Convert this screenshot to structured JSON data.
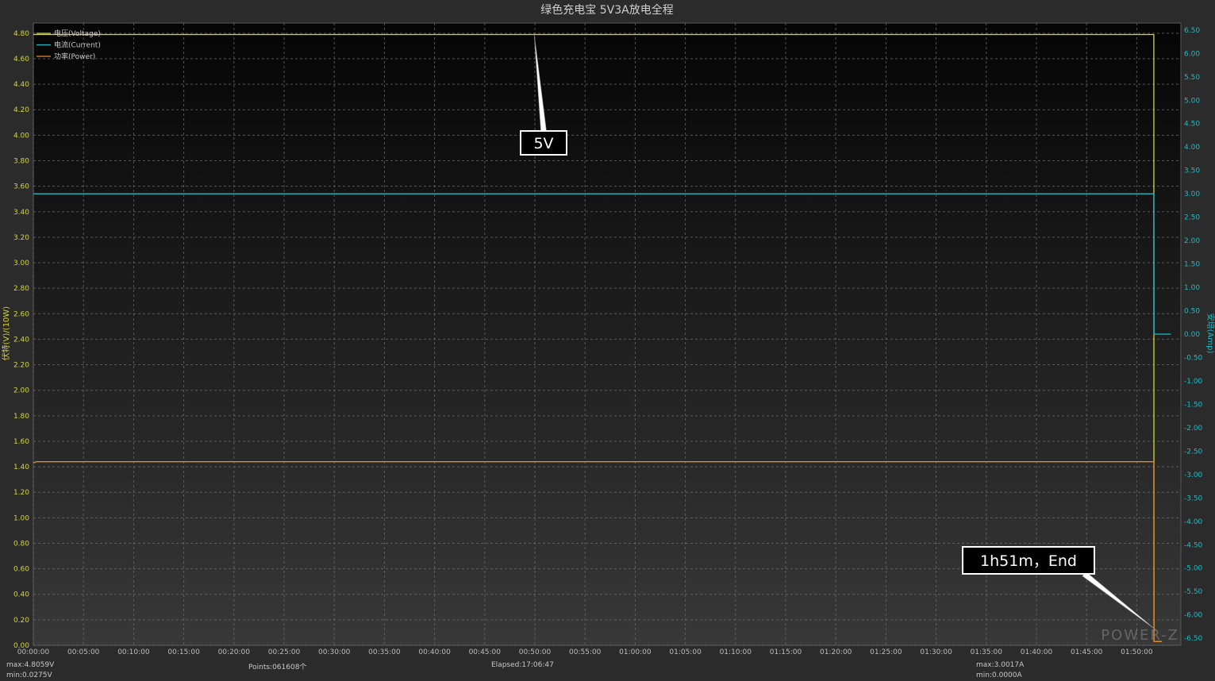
{
  "chart_data": {
    "type": "line",
    "title": "绿色充电宝 5V3A放电全程",
    "x": [
      "00:00:00",
      "00:05:00",
      "00:10:00",
      "00:15:00",
      "00:20:00",
      "00:25:00",
      "00:30:00",
      "00:35:00",
      "00:40:00",
      "00:45:00",
      "00:50:00",
      "00:55:00",
      "01:00:00",
      "01:05:00",
      "01:10:00",
      "01:15:00",
      "01:20:00",
      "01:25:00",
      "01:30:00",
      "01:35:00",
      "01:40:00",
      "01:45:00",
      "01:50:00"
    ],
    "xlim_minutes": [
      0,
      114.4
    ],
    "ylabel_left": "伏特(V)/(10W)",
    "ylabel_right": "安培(Amp)",
    "ylim_left": [
      0,
      4.88
    ],
    "ylim_right": [
      -6.65,
      6.65
    ],
    "yticks_left": [
      "0.00",
      "0.20",
      "0.40",
      "0.60",
      "0.80",
      "1.00",
      "1.20",
      "1.40",
      "1.60",
      "1.80",
      "2.00",
      "2.20",
      "2.40",
      "2.60",
      "2.80",
      "3.00",
      "3.20",
      "3.40",
      "3.60",
      "3.80",
      "4.00",
      "4.20",
      "4.40",
      "4.60",
      "4.80"
    ],
    "yticks_right": [
      "-6.50",
      "-6.00",
      "-5.50",
      "-5.00",
      "-4.50",
      "-4.00",
      "-3.50",
      "-3.00",
      "-2.50",
      "-2.00",
      "-1.50",
      "-1.00",
      "-0.50",
      "0.00",
      "0.50",
      "1.00",
      "1.50",
      "2.00",
      "2.50",
      "3.00",
      "3.50",
      "4.00",
      "4.50",
      "5.00",
      "5.50",
      "6.00",
      "6.50"
    ],
    "grid": true,
    "legend_position": "top-left",
    "series": [
      {
        "name": "电压(Voltage)",
        "color": "#d4d43a",
        "axis": "left",
        "points": [
          [
            0,
            4.79
          ],
          [
            111.7,
            4.79
          ],
          [
            111.72,
            0.03
          ],
          [
            112.5,
            0.03
          ]
        ]
      },
      {
        "name": "电流(Current)",
        "color": "#22b8c4",
        "axis": "right",
        "points": [
          [
            0,
            3.0
          ],
          [
            111.7,
            3.0
          ],
          [
            111.72,
            0.0
          ],
          [
            113.4,
            0.0
          ]
        ]
      },
      {
        "name": "功率(Power)",
        "color": "#e8862a",
        "axis": "left",
        "points": [
          [
            0,
            1.43
          ],
          [
            0.3,
            1.44
          ],
          [
            111.7,
            1.44
          ],
          [
            111.72,
            0.03
          ],
          [
            112.5,
            0.03
          ]
        ]
      }
    ],
    "annotations": [
      {
        "text": "5V",
        "target_minute": 50.0,
        "target_value": 4.8
      },
      {
        "text": "1h51m，End",
        "target_minute": 112.0,
        "target_value": 0.12
      }
    ]
  },
  "watermark": "POWER-Z",
  "status": {
    "voltage_max": "max:4.8059V",
    "voltage_min": "min:0.0275V",
    "points": "Points:061608个",
    "elapsed": "Elapsed:17:06:47",
    "current_max": "max:3.0017A",
    "current_min": "min:0.0000A"
  }
}
